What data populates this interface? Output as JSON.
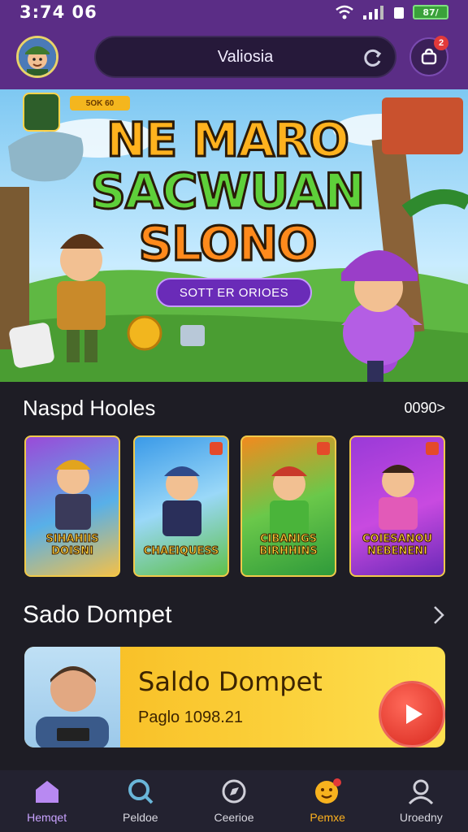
{
  "status_bar": {
    "time": "3:74 06",
    "battery": "87/"
  },
  "header": {
    "search_text": "Valiosia",
    "notification_count": "2"
  },
  "hero": {
    "tag": "5OK 60",
    "title_lines": [
      "NE MARO",
      "SACWUAN",
      "SLONO"
    ],
    "cta_label": "SOTT ER ORIOES"
  },
  "featured_section": {
    "title": "Naspd Hooles",
    "link_label": "0090>"
  },
  "game_cards": [
    {
      "label": "SIHAHIIS DOISNI"
    },
    {
      "label": "CHAEIQUESS"
    },
    {
      "label": "CIBANIGS BIRHHINS"
    },
    {
      "label": "COIESANOU NEBENENI"
    }
  ],
  "wallet_section": {
    "title": "Sado Dompet",
    "card_title": "Saldo Dompet",
    "card_amount": "Paglo 1098.21"
  },
  "bottom_nav": [
    {
      "label": "Hemqet",
      "icon": "home-icon"
    },
    {
      "label": "Peldoe",
      "icon": "search-icon"
    },
    {
      "label": "Ceerioe",
      "icon": "compass-icon"
    },
    {
      "label": "Pemxe",
      "icon": "emoji-icon"
    },
    {
      "label": "Uroedny",
      "icon": "user-icon"
    }
  ],
  "colors": {
    "header_purple": "#5b2d86",
    "background_dark": "#1e1d25",
    "accent_yellow": "#fbd03a",
    "play_red": "#d8281e"
  }
}
